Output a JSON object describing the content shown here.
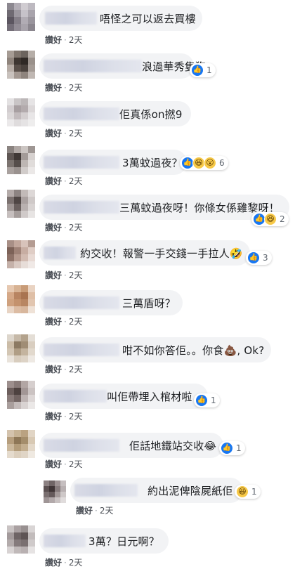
{
  "comments": [
    {
      "text": "唔怪之可以返去買樓",
      "like_label": "讚好",
      "separator": "·",
      "time": "2天",
      "reactions": null
    },
    {
      "text": "浪過華秀隻狗",
      "like_label": "讚好",
      "separator": "·",
      "time": "2天",
      "reactions": {
        "icons": [
          "like-icon"
        ],
        "count": "1"
      }
    },
    {
      "text": "佢真係on撚9",
      "like_label": "讚好",
      "separator": "·",
      "time": "2天",
      "reactions": null
    },
    {
      "text": "3萬蚊過夜？",
      "like_label": "讚好",
      "separator": "·",
      "time": "2天",
      "reactions": {
        "icons": [
          "like-icon",
          "haha-icon",
          "wow-icon"
        ],
        "count": "6"
      }
    },
    {
      "text": "三萬蚊過夜呀！你條女係雞黎呀！",
      "like_label": "讚好",
      "separator": "·",
      "time": "2天",
      "reactions": {
        "icons": [
          "like-icon",
          "haha-icon"
        ],
        "count": "2"
      }
    },
    {
      "text": "約交收！報警一手交錢一手拉人🤣",
      "like_label": "讚好",
      "separator": "·",
      "time": "2天",
      "reactions": {
        "icons": [
          "like-icon"
        ],
        "count": "3"
      }
    },
    {
      "text": "三萬盾呀？",
      "like_label": "讚好",
      "separator": "·",
      "time": "2天",
      "reactions": null
    },
    {
      "text": "咁不如你答佢。。你食💩, Ok?",
      "like_label": "讚好",
      "separator": "·",
      "time": "2天",
      "reactions": null
    },
    {
      "text": "叫佢帶埋入棺材啦",
      "like_label": "讚好",
      "separator": "·",
      "time": "2天",
      "reactions": {
        "icons": [
          "like-icon"
        ],
        "count": "1"
      }
    },
    {
      "text": "佢話地鐵站交收😂",
      "like_label": "讚好",
      "separator": "·",
      "time": "2天",
      "reactions": {
        "icons": [
          "like-icon"
        ],
        "count": "1"
      }
    },
    {
      "text": "約出泥俾陰屍紙佢",
      "like_label": "讚好",
      "separator": "·",
      "time": "2天",
      "reactions": {
        "icons": [
          "haha-icon"
        ],
        "count": "1"
      }
    },
    {
      "text": "3萬？日元啊？",
      "like_label": "讚好",
      "separator": "·",
      "time": "2天",
      "reactions": null
    }
  ],
  "colors": {
    "bubble": "#f2f3f5",
    "meta": "#4b4f56",
    "like_blue": "#1877f2",
    "haha_yellow": "#f7c948"
  }
}
